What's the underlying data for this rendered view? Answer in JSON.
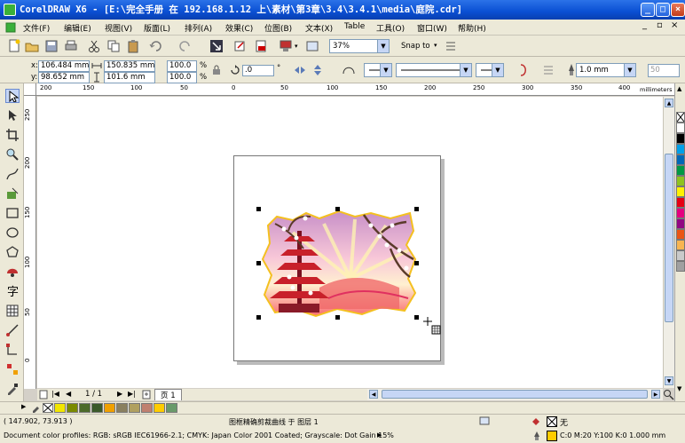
{
  "window": {
    "title": "CorelDRAW X6 - [E:\\完全手册 在 192.168.1.12 上\\素材\\第3章\\3.4\\3.4.1\\media\\庭院.cdr]"
  },
  "menu": [
    "文件(F)",
    "编辑(E)",
    "视图(V)",
    "版面(L)",
    "排列(A)",
    "效果(C)",
    "位图(B)",
    "文本(X)",
    "Table",
    "工具(O)",
    "窗口(W)",
    "帮助(H)"
  ],
  "toolbar": {
    "zoom": "37%",
    "snap_label": "Snap to"
  },
  "property_bar": {
    "x_label": "x:",
    "x": "106.484 mm",
    "y_label": "y:",
    "y": "98.652 mm",
    "width": "150.835 mm",
    "height": "101.6 mm",
    "scale_x": "100.0",
    "scale_y": "100.0",
    "pct": "%",
    "rotation": ".0",
    "deg": "°",
    "outline_width": "1.0 mm",
    "num_right": "50"
  },
  "ruler": {
    "unit": "millimeters",
    "h_ticks": [
      "200",
      "150",
      "100",
      "50",
      "0",
      "50",
      "100",
      "150",
      "200",
      "250",
      "300",
      "350",
      "400"
    ],
    "v_ticks": [
      "250",
      "200",
      "150",
      "100",
      "50",
      "0"
    ]
  },
  "page_nav": {
    "counter": "1 / 1",
    "page_tab": "页 1"
  },
  "status": {
    "coords": "( 147.902, 73.913 )",
    "object_info": "图框精确剪裁曲线 于 图层 1",
    "profiles": "Document color profiles: RGB: sRGB IEC61966-2.1; CMYK: Japan Color 2001 Coated; Grayscale: Dot Gain 15%",
    "fill_none": "无",
    "outline_info": "C:0 M:20 Y:100 K:0  1.000 mm"
  },
  "colors": {
    "title_bar": "#0a4fd3",
    "outline_swatch": "#ffcc00",
    "palette": [
      "#ffffff",
      "#000000",
      "#00a0e9",
      "#0068b7",
      "#009944",
      "#8fc31f",
      "#fff100",
      "#e60012",
      "#e4007f",
      "#920783",
      "#ea5514",
      "#f8b551",
      "#c9caca",
      "#a0a0a0"
    ],
    "doc_palette": [
      "#f2e600",
      "#7a8a00",
      "#4c6a2a",
      "#3b5a2a",
      "#f0a000",
      "#8a8060",
      "#b0a060",
      "#c08070",
      "#ffcc00",
      "#6a9a6a"
    ]
  }
}
